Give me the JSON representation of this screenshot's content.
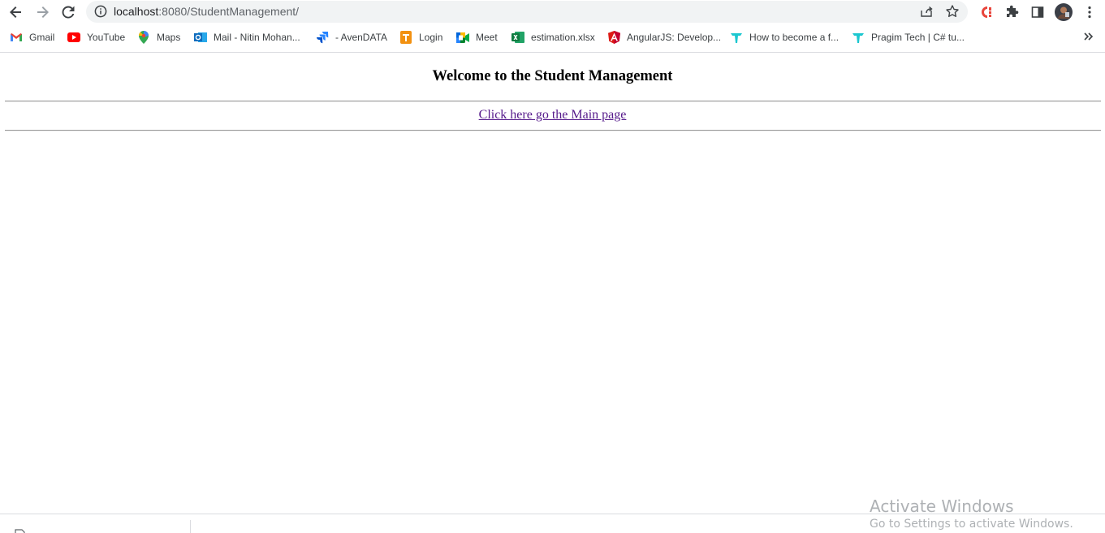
{
  "browser": {
    "url_host": "localhost",
    "url_path": ":8080/StudentManagement/",
    "bookmarks": [
      {
        "label": "Gmail",
        "icon": "gmail-icon",
        "color": "#ea4335"
      },
      {
        "label": "YouTube",
        "icon": "youtube-icon",
        "color": "#ff0000"
      },
      {
        "label": "Maps",
        "icon": "maps-icon",
        "color": "#34a853"
      },
      {
        "label": "Mail - Nitin Mohan...",
        "icon": "outlook-icon",
        "color": "#0f6cbd"
      },
      {
        "label": "- AvenDATA",
        "icon": "jira-icon",
        "color": "#2684ff"
      },
      {
        "label": "Login",
        "icon": "login-icon",
        "color": "#f29111"
      },
      {
        "label": "Meet",
        "icon": "meet-icon",
        "color": "#00897b"
      },
      {
        "label": "estimation.xlsx",
        "icon": "excel-icon",
        "color": "#107c41"
      },
      {
        "label": "AngularJS: Develop...",
        "icon": "angular-icon",
        "color": "#dd1b16"
      },
      {
        "label": "How to become a f...",
        "icon": "pragim-icon",
        "color": "#1cc7d0"
      },
      {
        "label": "Pragim Tech | C# tu...",
        "icon": "pragim-icon",
        "color": "#1cc7d0"
      }
    ]
  },
  "page": {
    "heading": "Welcome to the Student Management",
    "link_text": "Click here go the Main page",
    "link_color": "#551a8b"
  },
  "watermark": {
    "title": "Activate Windows",
    "subtitle": "Go to Settings to activate Windows."
  }
}
